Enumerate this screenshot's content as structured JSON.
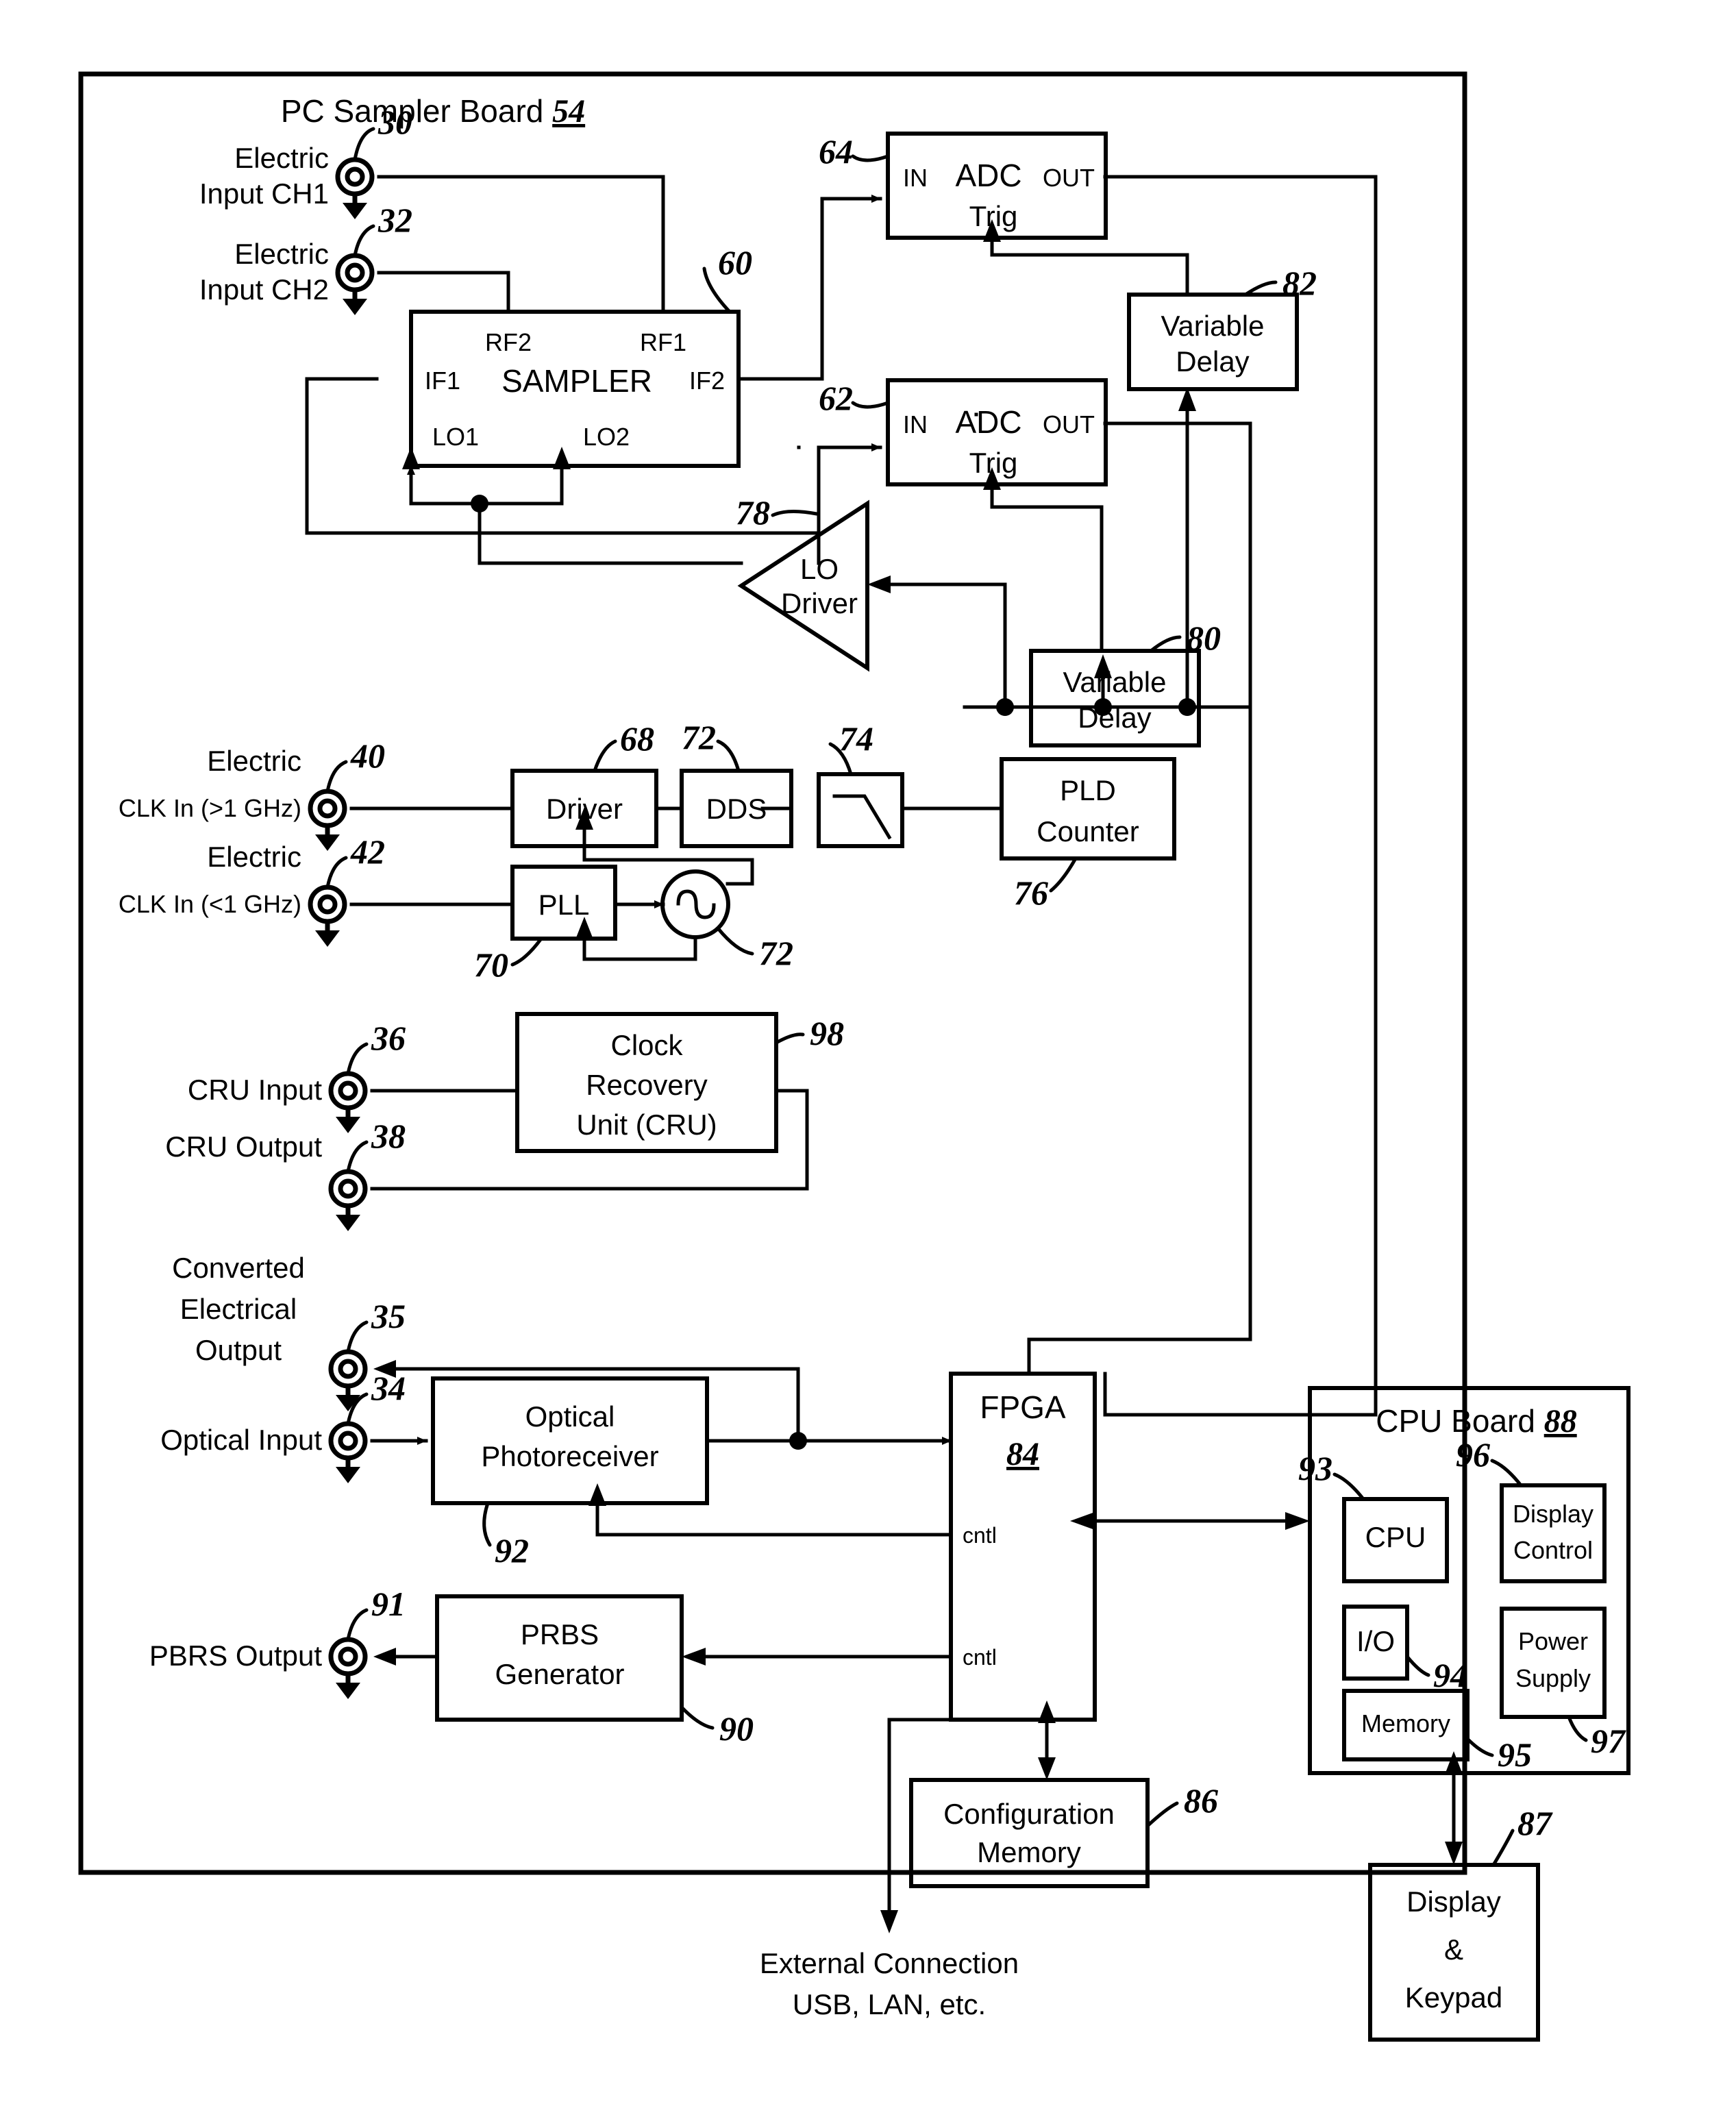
{
  "figure": {
    "board_title": "PC Sampler Board",
    "board_ref": "54",
    "cpu_board_title": "CPU Board",
    "cpu_board_ref": "88"
  },
  "ports": [
    {
      "id": "p30",
      "label_line1": "Electric",
      "label_line2": "Input CH1",
      "ref": "30"
    },
    {
      "id": "p32",
      "label_line1": "Electric",
      "label_line2": "Input CH2",
      "ref": "32"
    },
    {
      "id": "p40",
      "label_line1": "Electric",
      "label_line2": "CLK In (>1 GHz)",
      "ref": "40"
    },
    {
      "id": "p42",
      "label_line1": "Electric",
      "label_line2": "CLK In (<1 GHz)",
      "ref": "42"
    },
    {
      "id": "p36",
      "label_line1": "CRU Input",
      "label_line2": "",
      "ref": "36"
    },
    {
      "id": "p38",
      "label_line1": "CRU Output",
      "label_line2": "",
      "ref": "38"
    },
    {
      "id": "p35",
      "label_line1": "Converted",
      "label_line2": "Electrical",
      "label_line3": "Output",
      "ref": "35"
    },
    {
      "id": "p34",
      "label_line1": "Optical Input",
      "label_line2": "",
      "ref": "34"
    },
    {
      "id": "p91",
      "label_line1": "PBRS Output",
      "label_line2": "",
      "ref": "91"
    }
  ],
  "blocks": {
    "sampler": {
      "name": "SAMPLER",
      "ref": "60",
      "pins": {
        "rf2": "RF2",
        "rf1": "RF1",
        "if1": "IF1",
        "if2": "IF2",
        "lo1": "LO1",
        "lo2": "LO2"
      }
    },
    "adc64": {
      "name": "ADC",
      "ref": "64",
      "pin_in": "IN",
      "pin_out": "OUT",
      "pin_trig": "Trig"
    },
    "adc62": {
      "name": "ADC",
      "ref": "62",
      "pin_in": "IN",
      "pin_out": "OUT",
      "pin_trig": "Trig"
    },
    "vdelay82": {
      "line1": "Variable",
      "line2": "Delay",
      "ref": "82"
    },
    "vdelay80": {
      "line1": "Variable",
      "line2": "Delay",
      "ref": "80"
    },
    "lo_driver": {
      "line1": "LO",
      "line2": "Driver",
      "ref": "78"
    },
    "driver": {
      "name": "Driver",
      "ref": "68"
    },
    "dds": {
      "name": "DDS",
      "ref": "72"
    },
    "filter": {
      "name": "",
      "ref": "74",
      "icon": "lowpass-filter-icon"
    },
    "pld": {
      "line1": "PLD",
      "line2": "Counter",
      "ref": "76"
    },
    "pll": {
      "name": "PLL",
      "ref": "70"
    },
    "vco": {
      "name": "",
      "ref": "72",
      "icon": "oscillator-icon"
    },
    "cru": {
      "line1": "Clock",
      "line2": "Recovery",
      "line3": "Unit (CRU)",
      "ref": "98"
    },
    "photoreceiver": {
      "line1": "Optical",
      "line2": "Photoreceiver",
      "ref": "92"
    },
    "prbs": {
      "line1": "PRBS",
      "line2": "Generator",
      "ref": "90"
    },
    "fpga": {
      "name": "FPGA",
      "ref": "84",
      "pin_cntl_1": "cntl",
      "pin_cntl_2": "cntl"
    },
    "config_mem": {
      "line1": "Configuration",
      "line2": "Memory",
      "ref": "86"
    },
    "cpu": {
      "name": "CPU",
      "ref": "93"
    },
    "io": {
      "name": "I/O",
      "ref": "94"
    },
    "memory": {
      "name": "Memory",
      "ref": "95"
    },
    "display_control": {
      "line1": "Display",
      "line2": "Control",
      "ref": "96"
    },
    "power_supply": {
      "line1": "Power",
      "line2": "Supply",
      "ref": "97"
    },
    "display_keypad": {
      "line1": "Display",
      "line2": "&",
      "line3": "Keypad",
      "ref": "87"
    }
  },
  "annotations": {
    "external_connection_line1": "External Connection",
    "external_connection_line2": "USB, LAN, etc."
  }
}
